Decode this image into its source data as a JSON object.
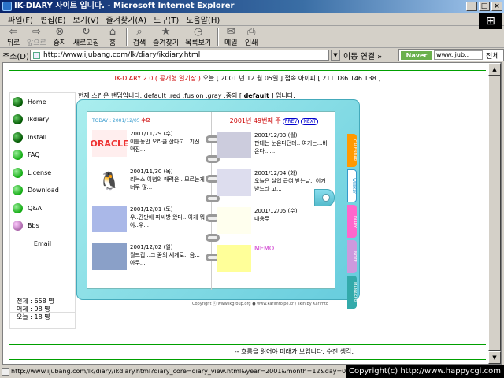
{
  "window": {
    "title": "IK-DIARY 사이트 입니다. - Microsoft Internet Explorer"
  },
  "menu": [
    "파일(F)",
    "편집(E)",
    "보기(V)",
    "즐겨찾기(A)",
    "도구(T)",
    "도움말(H)"
  ],
  "toolbar": {
    "back": "뒤로",
    "forward": "앞으로",
    "stop": "중지",
    "refresh": "새로고침",
    "home": "홈",
    "search": "검색",
    "favorites": "즐겨찾기",
    "history": "목록보기",
    "mail": "메일",
    "print": "인쇄"
  },
  "address": {
    "label": "주소(D)",
    "url": "http://www.ijubang.com/lk/diary/ikdiary.html",
    "go": "이동",
    "links": "연결 »",
    "naver_logo": "Naver",
    "naver_input": "www.ijub..",
    "naver_all": "전체"
  },
  "header": {
    "title": "IK-DIARY 2.0 ( 공개형 일기장 )",
    "rest": " 오늘 [ 2001 년 12 월 05일 ] 접속 아이피 [ 211.186.146.138 ]"
  },
  "sidebar": {
    "items": [
      "Home",
      "Ikdiary",
      "Install",
      "FAQ",
      "License",
      "Download",
      "Q&A",
      "Bbs"
    ],
    "email": "Email"
  },
  "stats": {
    "total": "전체 : 658 명",
    "yesterday": "어제 : 98 명",
    "today": "오늘 : 18 명"
  },
  "intro": {
    "pre": "현재 스킨은 랜덤입니다. default ,red ,fusion ,gray ,중의 [ ",
    "skin": "default",
    "post": " ] 입니다."
  },
  "diary": {
    "today_label": "TODAY : 2001/12/05",
    "today_day": "수요",
    "week": "2001년 49번째 주",
    "prev": "PREV",
    "next": "NEXT",
    "left_entries": [
      {
        "thumb": "ORACLE",
        "date": "2001/11/29 (수)",
        "text": "이틀동안 오라클 깐다고.. 기진 맥진..."
      },
      {
        "thumb": "penguin",
        "date": "2001/11/30 (목)",
        "text": "리눅스 이념의 매력은.. 모르는게 너무 많..."
      },
      {
        "thumb": "",
        "date": "2001/12/01 (토)",
        "text": "우..간만에 피씨방 왔다.. 이게 뭐야..우..."
      },
      {
        "thumb": "",
        "date": "2001/12/02 (일)",
        "text": "월드컵...그 꿈의 세계로.. 음... 아무..."
      }
    ],
    "right_entries": [
      {
        "date": "2001/12/03 (월)",
        "text": "판대는 눈온다던데.. 여기는...비온다......"
      },
      {
        "date": "2001/12/04 (화)",
        "text": "오늘은 실업 급여 받는날.. 이거 받느라 고..."
      },
      {
        "date": "2001/12/05 (수)",
        "text": "내용무"
      },
      {
        "date": "MEMO",
        "text": ""
      }
    ],
    "tabs": [
      "CALENDAR",
      "WEEKLY",
      "DIARY",
      "NOTE",
      "MANAGER"
    ],
    "copyright": "Copyright ⓒ www.ikgroup.org ● www.karimto.pe.kr / skin by Karimto"
  },
  "footer": "-- 흐름을 읽어야 미래가 보입니다. 수진 생각.",
  "status": "http://www.ijubang.com/lk/diary/ikdiary.html?diary_core=diary_view.html&year=2001&month=12&day=02&skin=def",
  "watermark": "Copyright(c) http://www.happycgi.com"
}
